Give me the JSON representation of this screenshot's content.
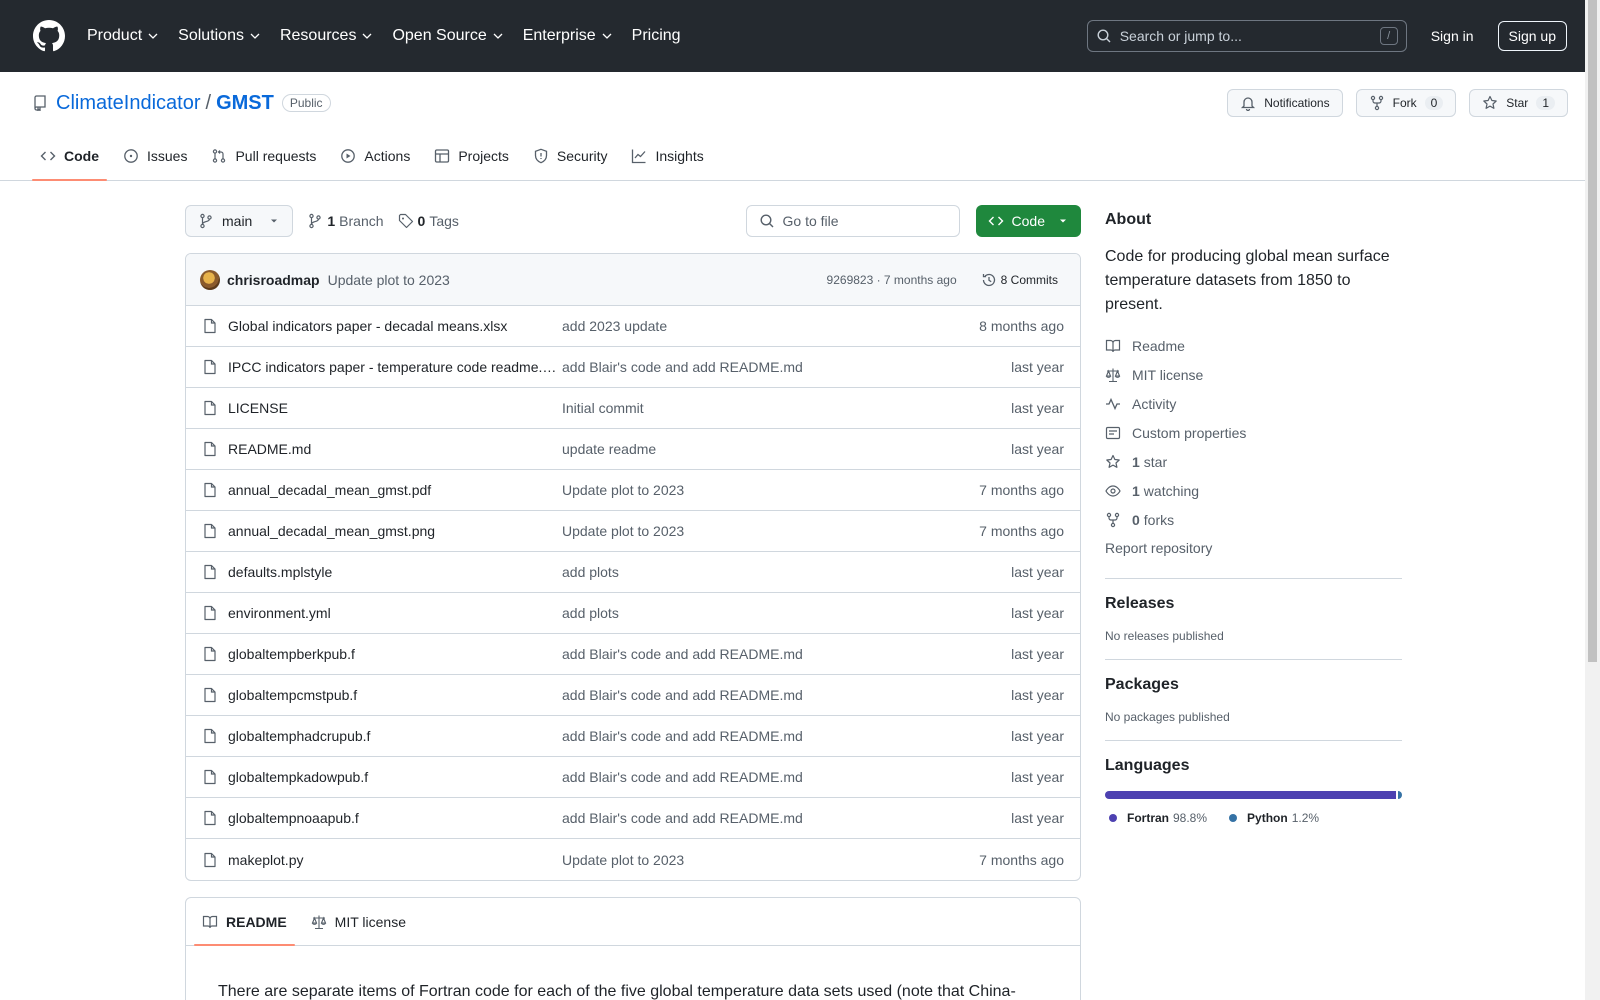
{
  "header": {
    "nav": [
      "Product",
      "Solutions",
      "Resources",
      "Open Source",
      "Enterprise",
      "Pricing"
    ],
    "search_placeholder": "Search or jump to...",
    "search_shortcut": "/",
    "signin": "Sign in",
    "signup": "Sign up"
  },
  "repo": {
    "owner": "ClimateIndicator",
    "separator": "/",
    "name": "GMST",
    "visibility": "Public",
    "notifications": "Notifications",
    "fork": "Fork",
    "fork_count": "0",
    "star": "Star",
    "star_count": "1"
  },
  "tabs": [
    "Code",
    "Issues",
    "Pull requests",
    "Actions",
    "Projects",
    "Security",
    "Insights"
  ],
  "toolbar": {
    "branch": "main",
    "branch_count": "1",
    "branch_label": "Branch",
    "tag_count": "0",
    "tag_label": "Tags",
    "goto_placeholder": "Go to file",
    "code_button": "Code"
  },
  "latest_commit": {
    "author": "chrisroadmap",
    "message": "Update plot to 2023",
    "meta": "9269823 · 7 months ago",
    "commits": "8 Commits"
  },
  "files": [
    {
      "name": "Global indicators paper - decadal means.xlsx",
      "commit": "add 2023 update",
      "age": "8 months ago"
    },
    {
      "name": "IPCC indicators paper - temperature code readme.docx",
      "commit": "add Blair's code and add README.md",
      "age": "last year"
    },
    {
      "name": "LICENSE",
      "commit": "Initial commit",
      "age": "last year"
    },
    {
      "name": "README.md",
      "commit": "update readme",
      "age": "last year"
    },
    {
      "name": "annual_decadal_mean_gmst.pdf",
      "commit": "Update plot to 2023",
      "age": "7 months ago"
    },
    {
      "name": "annual_decadal_mean_gmst.png",
      "commit": "Update plot to 2023",
      "age": "7 months ago"
    },
    {
      "name": "defaults.mplstyle",
      "commit": "add plots",
      "age": "last year"
    },
    {
      "name": "environment.yml",
      "commit": "add plots",
      "age": "last year"
    },
    {
      "name": "globaltempberkpub.f",
      "commit": "add Blair's code and add README.md",
      "age": "last year"
    },
    {
      "name": "globaltempcmstpub.f",
      "commit": "add Blair's code and add README.md",
      "age": "last year"
    },
    {
      "name": "globaltemphadcrupub.f",
      "commit": "add Blair's code and add README.md",
      "age": "last year"
    },
    {
      "name": "globaltempkadowpub.f",
      "commit": "add Blair's code and add README.md",
      "age": "last year"
    },
    {
      "name": "globaltempnoaapub.f",
      "commit": "add Blair's code and add README.md",
      "age": "last year"
    },
    {
      "name": "makeplot.py",
      "commit": "Update plot to 2023",
      "age": "7 months ago"
    }
  ],
  "readme": {
    "tab_readme": "README",
    "tab_license": "MIT license",
    "text": "There are separate items of Fortran code for each of the five global temperature data sets used (note that China-"
  },
  "about": {
    "heading": "About",
    "description": "Code for producing global mean surface temperature datasets from 1850 to present.",
    "readme": "Readme",
    "license": "MIT license",
    "activity": "Activity",
    "custom_properties": "Custom properties",
    "stars_count": "1",
    "stars_label": "star",
    "watching_count": "1",
    "watching_label": "watching",
    "forks_count": "0",
    "forks_label": "forks",
    "report": "Report repository"
  },
  "releases": {
    "heading": "Releases",
    "text": "No releases published"
  },
  "packages": {
    "heading": "Packages",
    "text": "No packages published"
  },
  "languages": {
    "heading": "Languages",
    "items": [
      {
        "name": "Fortran",
        "percent": "98.8%",
        "value": 98.8,
        "color": "#4d41b1"
      },
      {
        "name": "Python",
        "percent": "1.2%",
        "value": 1.2,
        "color": "#3572A5"
      }
    ]
  },
  "colors": {
    "accent": "#0969da",
    "primary_button": "#1f883d",
    "header_bg": "#24292f",
    "tab_underline": "#fd8c73"
  }
}
